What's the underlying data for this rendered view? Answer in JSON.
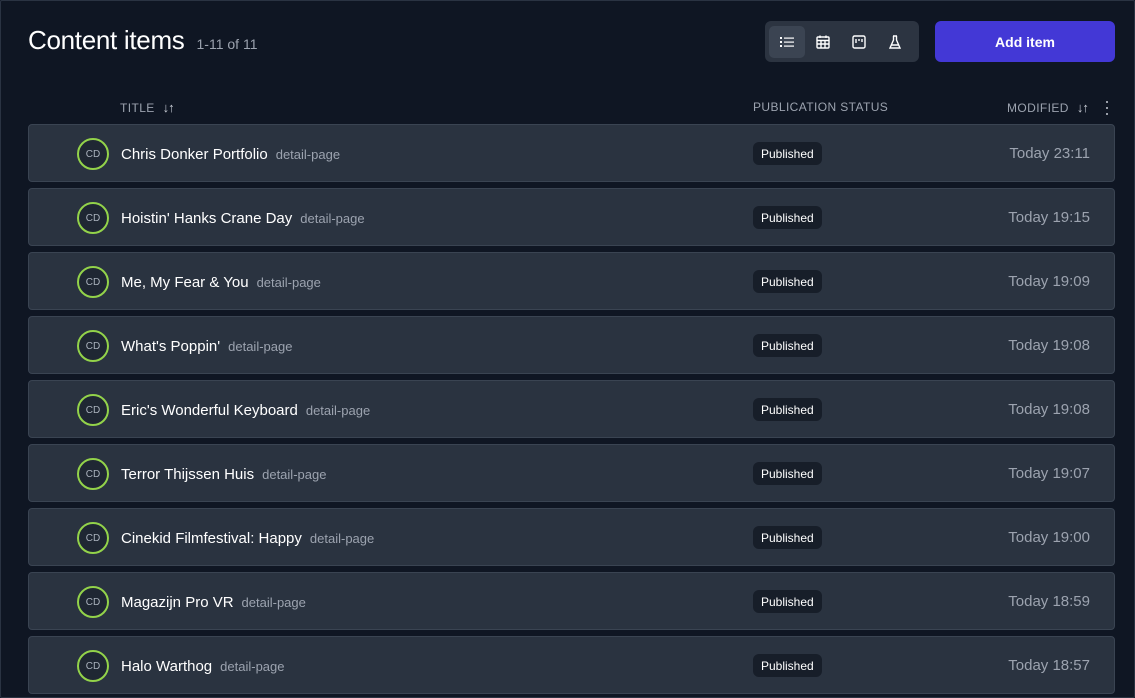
{
  "header": {
    "title": "Content items",
    "count": "1-11 of 11"
  },
  "view_switch": {
    "buttons": [
      {
        "icon": "list-icon",
        "active": true
      },
      {
        "icon": "calendar-icon",
        "active": false
      },
      {
        "icon": "board-icon",
        "active": false
      },
      {
        "icon": "flask-icon",
        "active": false
      }
    ]
  },
  "add_button": {
    "label": "Add item"
  },
  "columns": {
    "title": "Title",
    "title_sort": "↓↑",
    "status": "Publication status",
    "modified": "Modified",
    "modified_sort": "↓↑"
  },
  "colors": {
    "accent": "#4338d6",
    "avatar_ring": "#93d34a"
  },
  "rows": [
    {
      "avatar": "CD",
      "title": "Chris Donker Portfolio",
      "tag": "detail-page",
      "status": "Published",
      "modified": "Today 23:11"
    },
    {
      "avatar": "CD",
      "title": "Hoistin' Hanks Crane Day",
      "tag": "detail-page",
      "status": "Published",
      "modified": "Today 19:15"
    },
    {
      "avatar": "CD",
      "title": "Me, My Fear & You",
      "tag": "detail-page",
      "status": "Published",
      "modified": "Today 19:09"
    },
    {
      "avatar": "CD",
      "title": "What's Poppin'",
      "tag": "detail-page",
      "status": "Published",
      "modified": "Today 19:08"
    },
    {
      "avatar": "CD",
      "title": "Eric's Wonderful Keyboard",
      "tag": "detail-page",
      "status": "Published",
      "modified": "Today 19:08"
    },
    {
      "avatar": "CD",
      "title": "Terror Thijssen Huis",
      "tag": "detail-page",
      "status": "Published",
      "modified": "Today 19:07"
    },
    {
      "avatar": "CD",
      "title": "Cinekid Filmfestival: Happy",
      "tag": "detail-page",
      "status": "Published",
      "modified": "Today 19:00"
    },
    {
      "avatar": "CD",
      "title": "Magazijn Pro VR",
      "tag": "detail-page",
      "status": "Published",
      "modified": "Today 18:59"
    },
    {
      "avatar": "CD",
      "title": "Halo Warthog",
      "tag": "detail-page",
      "status": "Published",
      "modified": "Today 18:57"
    }
  ]
}
